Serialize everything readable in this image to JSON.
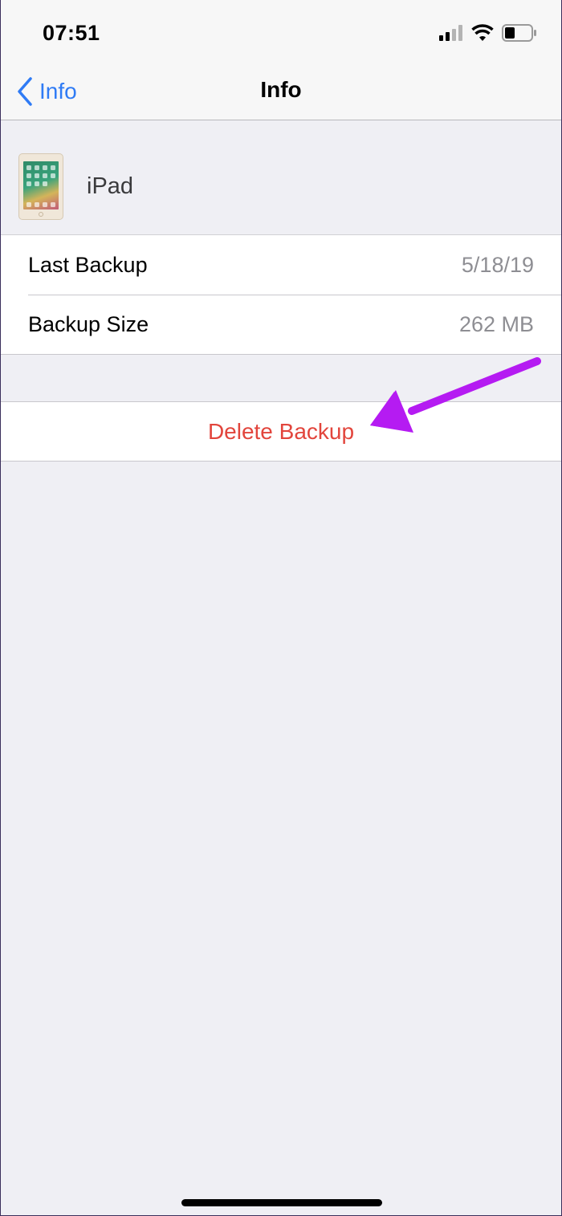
{
  "status_bar": {
    "time": "07:51",
    "icons": [
      "signal-icon",
      "wifi-icon",
      "battery-icon"
    ]
  },
  "nav": {
    "back_label": "Info",
    "title": "Info"
  },
  "device": {
    "name": "iPad",
    "icon": "ipad-thumbnail-icon"
  },
  "info_rows": [
    {
      "label": "Last Backup",
      "value": "5/18/19"
    },
    {
      "label": "Backup Size",
      "value": "262 MB"
    }
  ],
  "actions": {
    "delete_label": "Delete Backup"
  },
  "colors": {
    "accent": "#2f7bf5",
    "destructive": "#e2453c",
    "annotation": "#b51bf2",
    "background": "#efeff4"
  }
}
